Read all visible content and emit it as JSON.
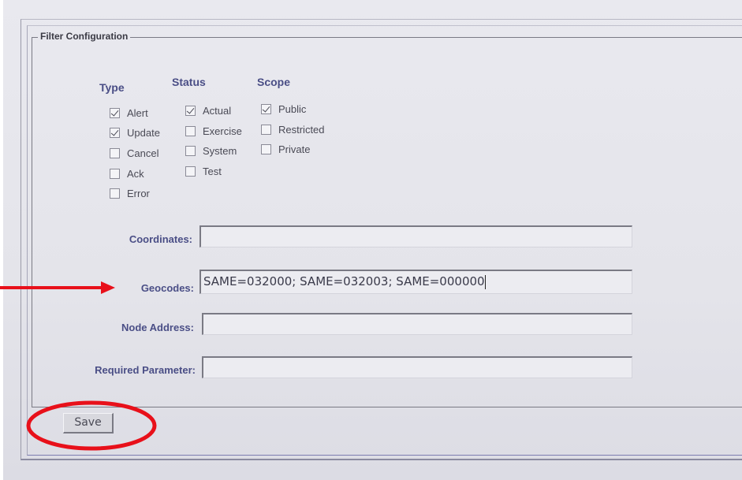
{
  "fieldset": {
    "legend": "Filter Configuration"
  },
  "columns": {
    "type": {
      "heading": "Type",
      "items": [
        {
          "label": "Alert",
          "checked": true
        },
        {
          "label": "Update",
          "checked": true
        },
        {
          "label": "Cancel",
          "checked": false
        },
        {
          "label": "Ack",
          "checked": false
        },
        {
          "label": "Error",
          "checked": false
        }
      ]
    },
    "status": {
      "heading": "Status",
      "items": [
        {
          "label": "Actual",
          "checked": true
        },
        {
          "label": "Exercise",
          "checked": false
        },
        {
          "label": "System",
          "checked": false
        },
        {
          "label": "Test",
          "checked": false
        }
      ]
    },
    "scope": {
      "heading": "Scope",
      "items": [
        {
          "label": "Public",
          "checked": true
        },
        {
          "label": "Restricted",
          "checked": false
        },
        {
          "label": "Private",
          "checked": false
        }
      ]
    }
  },
  "fields": {
    "coordinates": {
      "label": "Coordinates:",
      "value": ""
    },
    "geocodes": {
      "label": "Geocodes:",
      "value": "SAME=032000; SAME=032003; SAME=000000"
    },
    "node_address": {
      "label": "Node Address:",
      "value": ""
    },
    "required_parameter": {
      "label": "Required Parameter:",
      "value": ""
    }
  },
  "actions": {
    "save_label": "Save"
  },
  "annotations": {
    "color": "#e8101a"
  }
}
